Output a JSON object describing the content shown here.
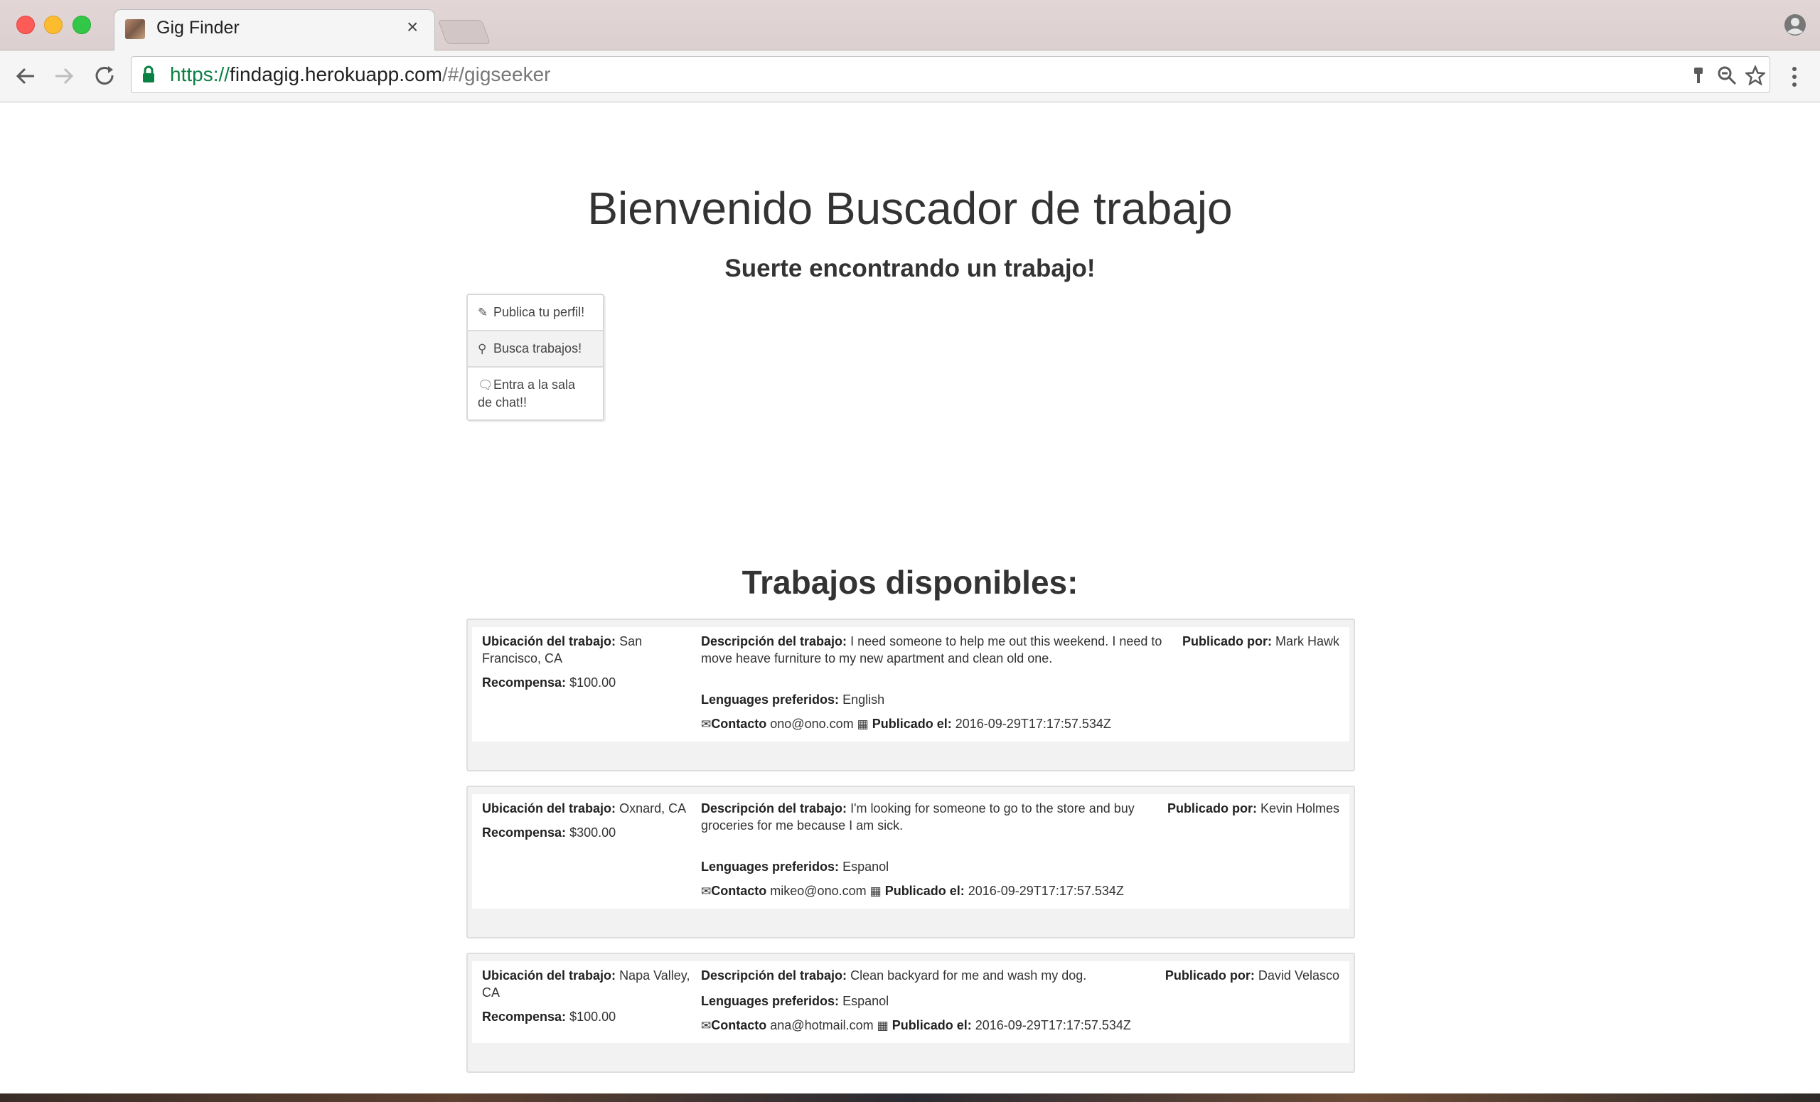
{
  "browser": {
    "tab_title": "Gig Finder",
    "tab_close": "×",
    "url_scheme": "https://",
    "url_host": "findagig.herokuapp.com",
    "url_path": "/#/gigseeker",
    "icons": [
      "back-icon",
      "forward-icon",
      "reload-icon",
      "lock-icon",
      "paint-brush-icon",
      "zoom-out-icon",
      "star-icon",
      "menu-icon",
      "profile-icon"
    ]
  },
  "header": {
    "title": "Bienvenido Buscador de trabajo",
    "subtitle": "Suerte encontrando un trabajo!"
  },
  "side_menu": {
    "items": [
      {
        "icon": "✎",
        "label": "Publica tu perfil!"
      },
      {
        "icon": "⚲",
        "label": "Busca trabajos!"
      },
      {
        "icon": "🗨",
        "label": "Entra a la sala de chat!!"
      }
    ]
  },
  "gigs_section": {
    "title": "Trabajos disponibles:",
    "labels": {
      "location": "Ubicación del trabajo:",
      "reward": "Recompensa:",
      "description": "Descripción del trabajo:",
      "languages": "Lenguages preferidos:",
      "contact": "Contacto",
      "posted_on": "Publicado el:",
      "posted_by": "Publicado por:"
    },
    "gigs": [
      {
        "location": "San Francisco, CA",
        "reward": "$100.00",
        "description": "I need someone to help me out this weekend. I need to move heave furniture to my new apartment and clean old one.",
        "languages": "English",
        "contact": "ono@ono.com",
        "posted_on": "2016-09-29T17:17:57.534Z",
        "posted_by": "Mark Hawk"
      },
      {
        "location": "Oxnard, CA",
        "reward": "$300.00",
        "description": "I'm looking for someone to go to the store and buy groceries for me because I am sick.",
        "languages": "Espanol",
        "contact": "mikeo@ono.com",
        "posted_on": "2016-09-29T17:17:57.534Z",
        "posted_by": "Kevin Holmes"
      },
      {
        "location": "Napa Valley, CA",
        "reward": "$100.00",
        "description": "Clean backyard for me and wash my dog.",
        "languages": "Espanol",
        "contact": "ana@hotmail.com",
        "posted_on": "2016-09-29T17:17:57.534Z",
        "posted_by": "David Velasco"
      }
    ]
  }
}
